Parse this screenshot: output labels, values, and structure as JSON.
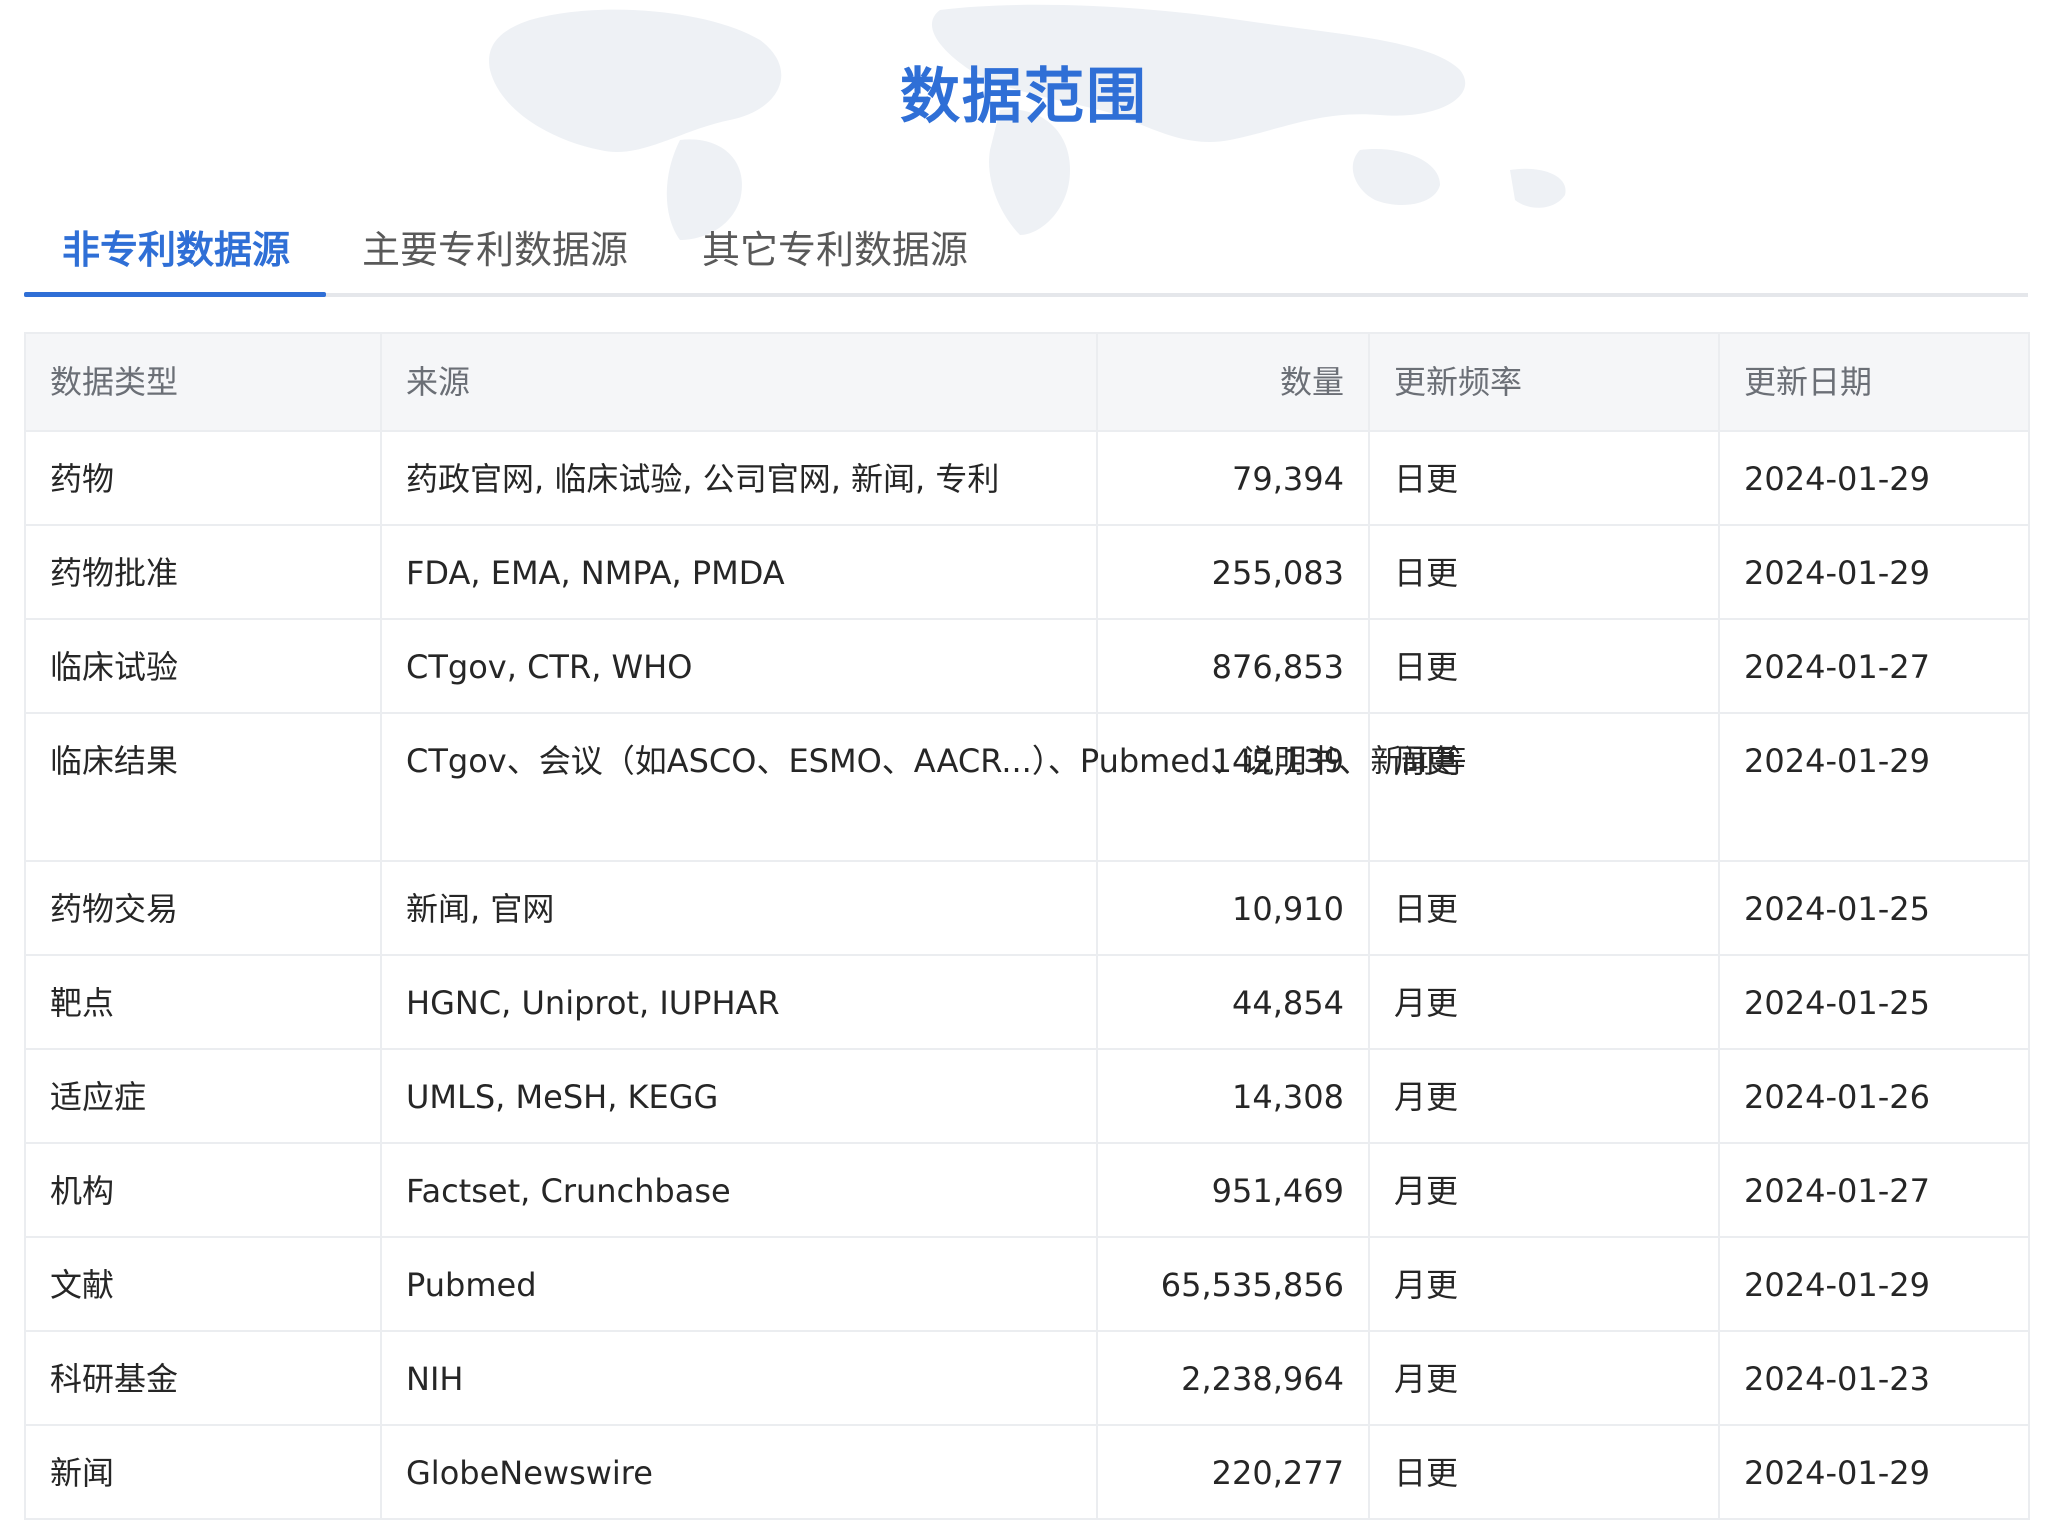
{
  "page": {
    "title": "数据范围",
    "accent_color": "#2f6fd6"
  },
  "tabs": [
    {
      "label": "非专利数据源",
      "active": true
    },
    {
      "label": "主要专利数据源",
      "active": false
    },
    {
      "label": "其它专利数据源",
      "active": false
    }
  ],
  "table": {
    "headers": {
      "type": "数据类型",
      "source": "来源",
      "count": "数量",
      "frequency": "更新频率",
      "date": "更新日期"
    },
    "rows": [
      {
        "type": "药物",
        "source": "药政官网, 临床试验, 公司官网, 新闻, 专利",
        "count": "79,394",
        "frequency": "日更",
        "date": "2024-01-29"
      },
      {
        "type": "药物批准",
        "source": "FDA, EMA, NMPA, PMDA",
        "count": "255,083",
        "frequency": "日更",
        "date": "2024-01-29"
      },
      {
        "type": "临床试验",
        "source": "CTgov, CTR, WHO",
        "count": "876,853",
        "frequency": "日更",
        "date": "2024-01-27"
      },
      {
        "type": "临床结果",
        "source": "CTgov、会议（如ASCO、ESMO、AACR...）、Pubmed、说明书、新闻等",
        "count": "142,139",
        "frequency": "周更",
        "date": "2024-01-29"
      },
      {
        "type": "药物交易",
        "source": "新闻, 官网",
        "count": "10,910",
        "frequency": "日更",
        "date": "2024-01-25"
      },
      {
        "type": "靶点",
        "source": "HGNC, Uniprot, IUPHAR",
        "count": "44,854",
        "frequency": "月更",
        "date": "2024-01-25"
      },
      {
        "type": "适应症",
        "source": "UMLS, MeSH, KEGG",
        "count": "14,308",
        "frequency": "月更",
        "date": "2024-01-26"
      },
      {
        "type": "机构",
        "source": "Factset, Crunchbase",
        "count": "951,469",
        "frequency": "月更",
        "date": "2024-01-27"
      },
      {
        "type": "文献",
        "source": "Pubmed",
        "count": "65,535,856",
        "frequency": "月更",
        "date": "2024-01-29"
      },
      {
        "type": "科研基金",
        "source": "NIH",
        "count": "2,238,964",
        "frequency": "月更",
        "date": "2024-01-23"
      },
      {
        "type": "新闻",
        "source": "GlobeNewswire",
        "count": "220,277",
        "frequency": "日更",
        "date": "2024-01-29"
      }
    ]
  }
}
